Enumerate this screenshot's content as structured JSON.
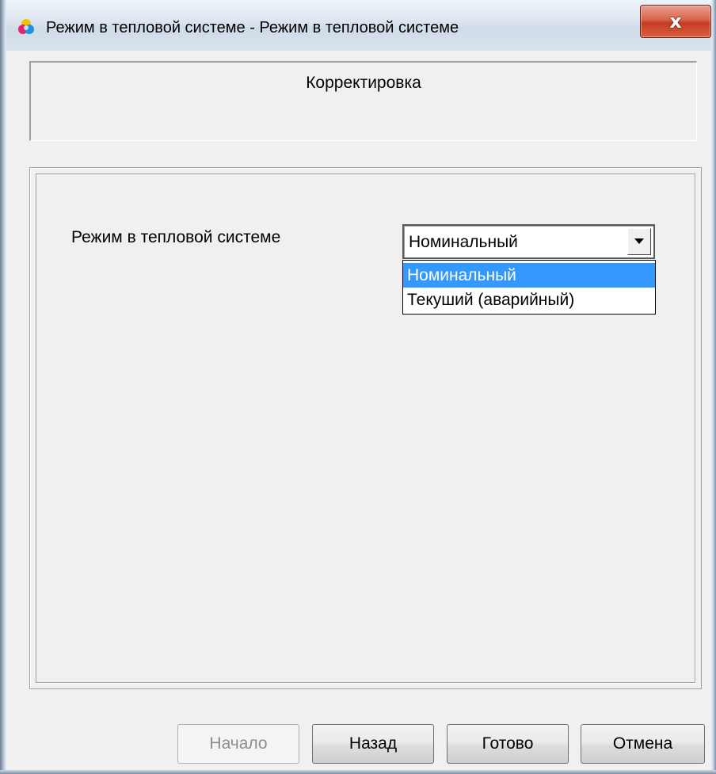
{
  "window": {
    "title": "Режим в тепловой системе - Режим в тепловой системе",
    "icon": "color-wheel-icon",
    "close_label": "x"
  },
  "header": {
    "title": "Корректировка"
  },
  "form": {
    "mode_label": "Режим в тепловой системе",
    "mode_select": {
      "value": "Номинальный",
      "options": [
        "Номинальный",
        "Текуший (аварийный)"
      ],
      "highlighted_option": "Номинальный"
    }
  },
  "buttons": {
    "start": "Начало",
    "back": "Назад",
    "finish": "Готово",
    "cancel": "Отмена"
  },
  "colors": {
    "selection": "#3399ff",
    "dialog_bg": "#f0f0f0",
    "close_button": "#c63c22"
  }
}
